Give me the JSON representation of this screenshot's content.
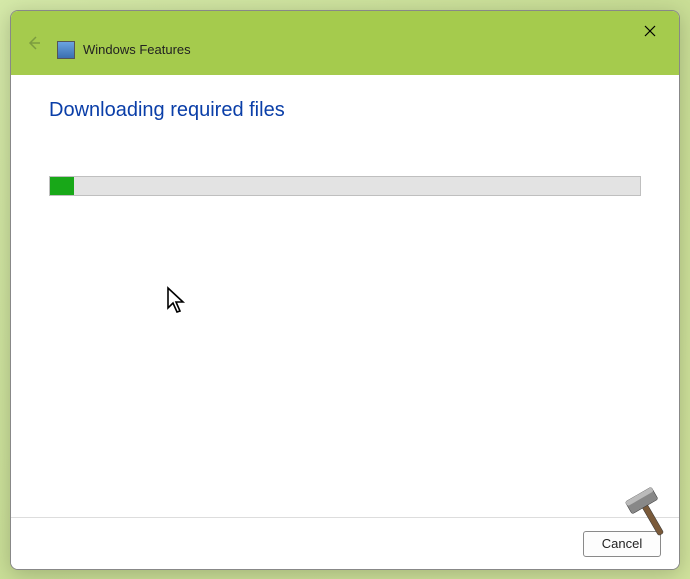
{
  "window": {
    "title": "Windows Features",
    "heading": "Downloading required files",
    "progress_percent": 4,
    "footer": {
      "cancel_label": "Cancel"
    }
  }
}
